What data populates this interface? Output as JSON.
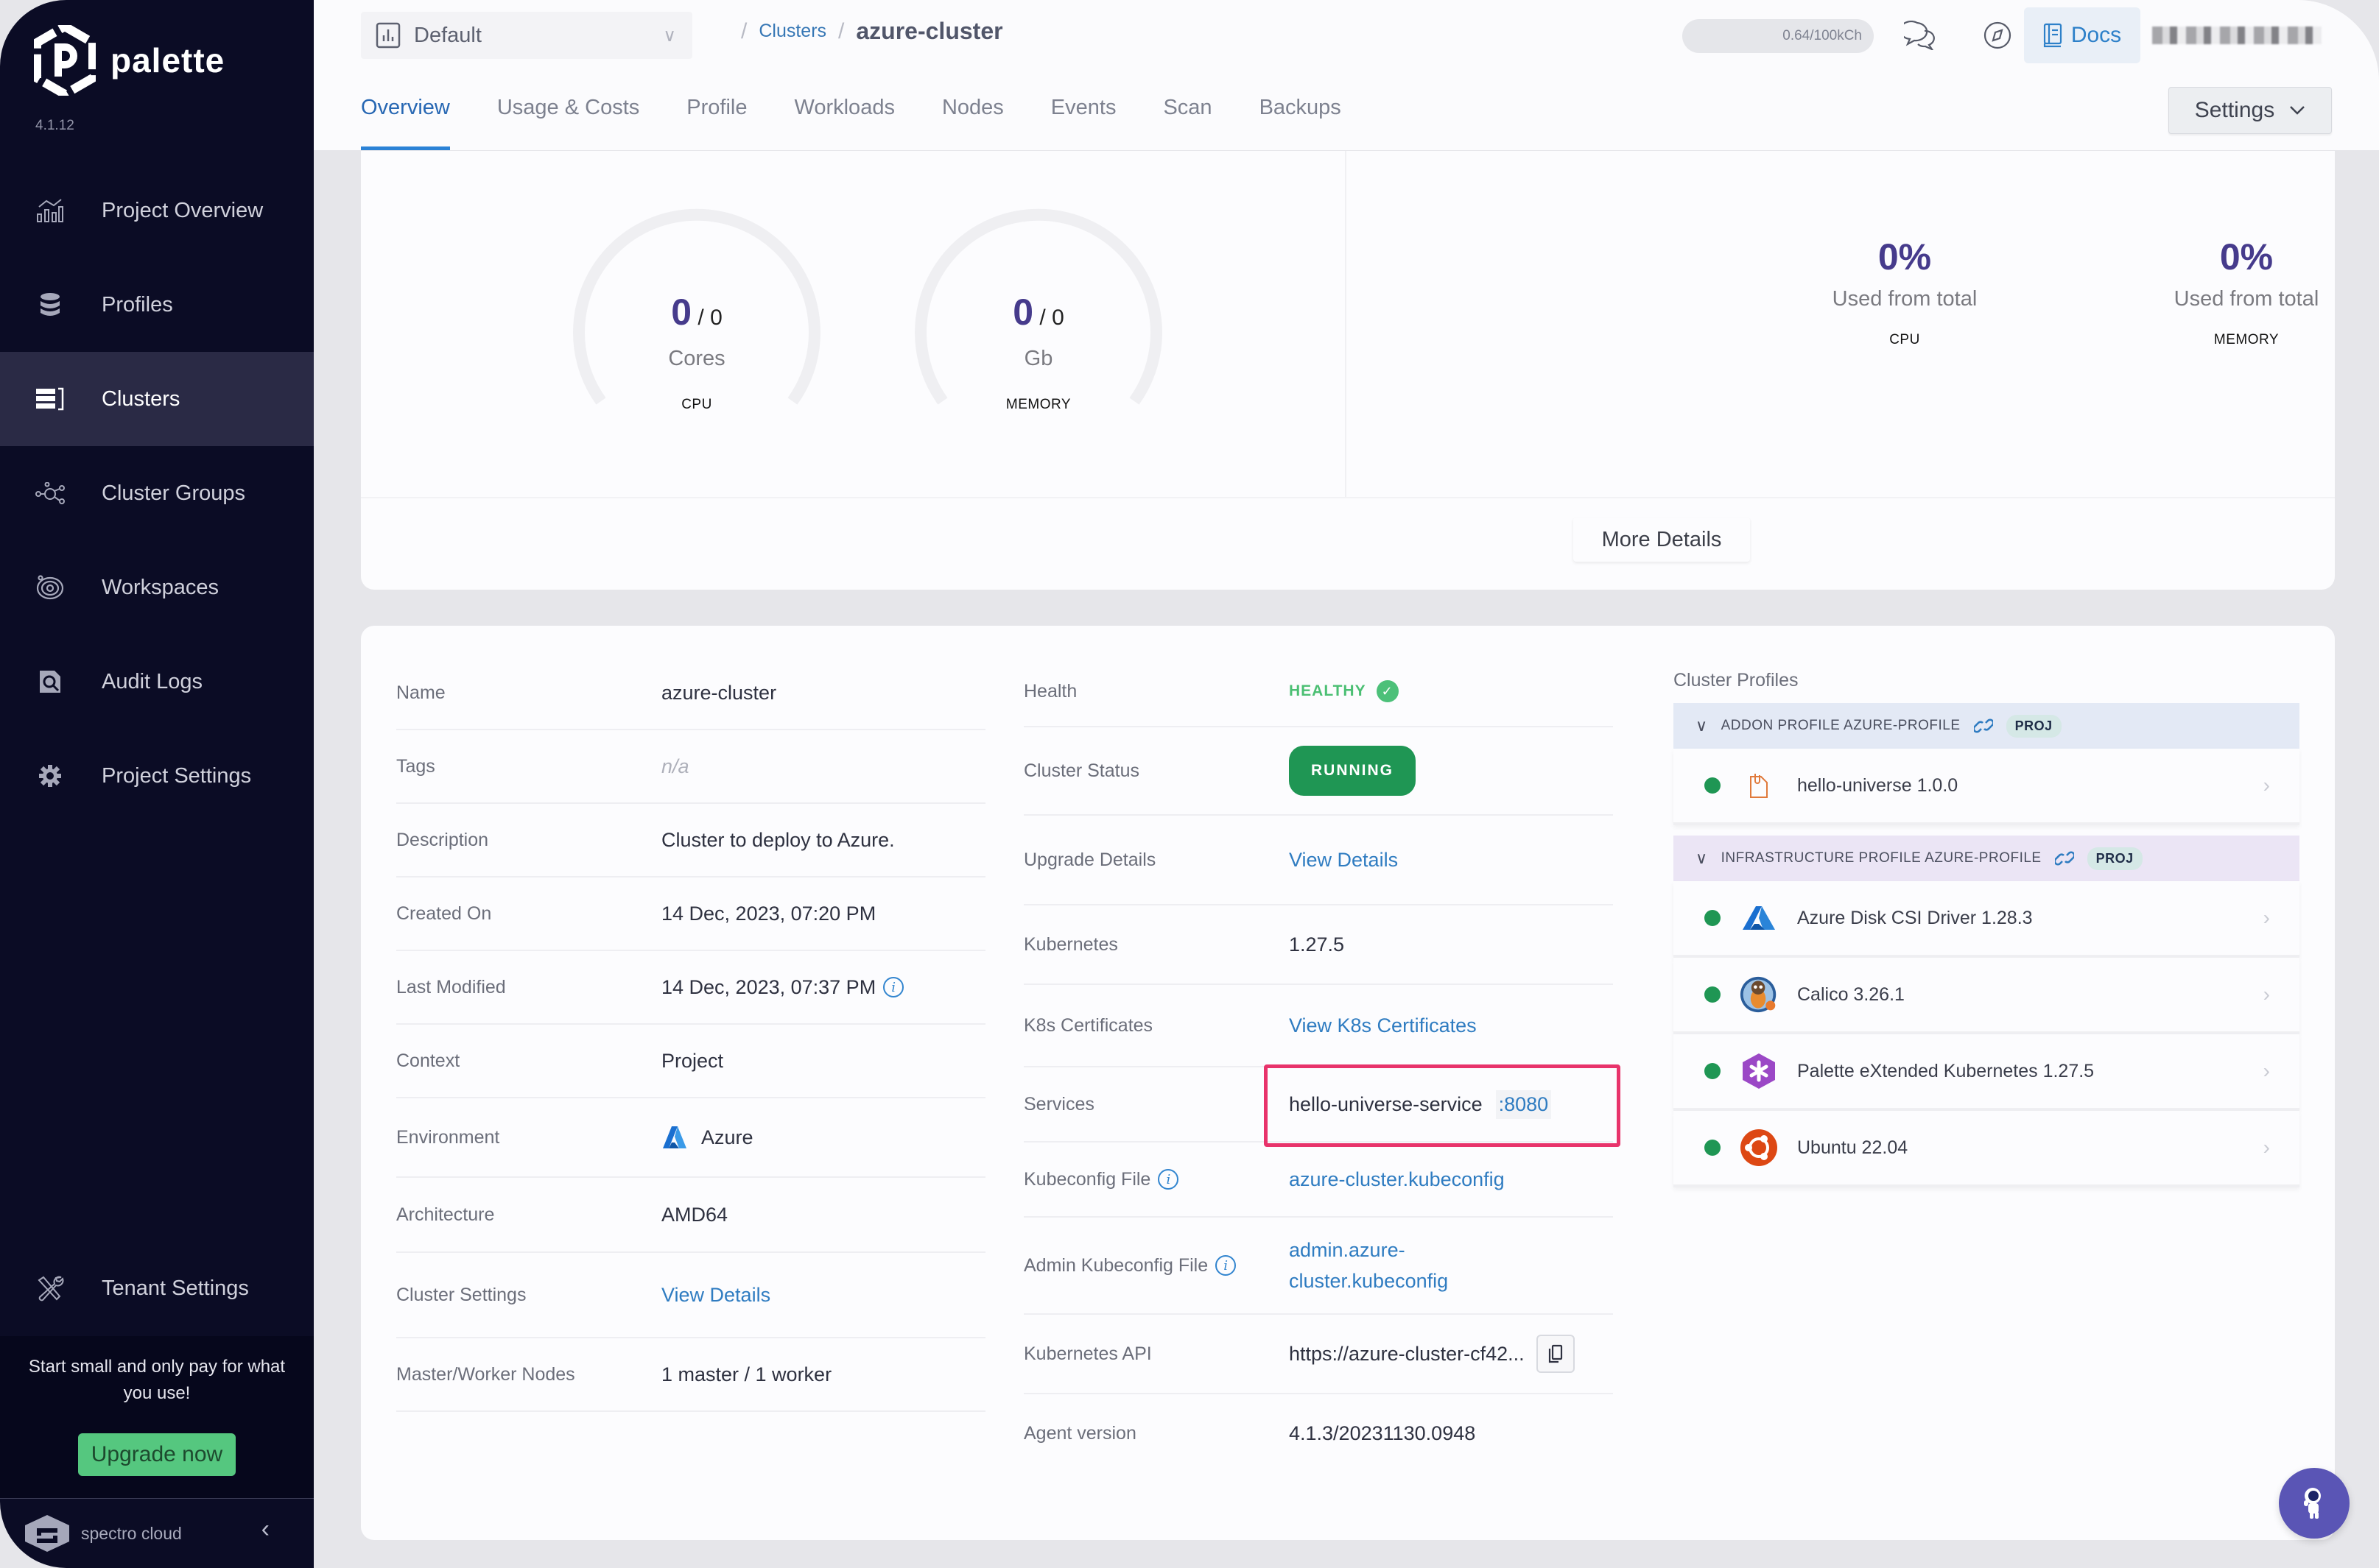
{
  "app": {
    "name": "palette",
    "version": "4.1.12",
    "footer_brand": "spectro cloud"
  },
  "sidebar": {
    "items": [
      {
        "label": "Project Overview",
        "icon": "chart-icon",
        "active": false
      },
      {
        "label": "Profiles",
        "icon": "stack-icon",
        "active": false
      },
      {
        "label": "Clusters",
        "icon": "clusters-icon",
        "active": true
      },
      {
        "label": "Cluster Groups",
        "icon": "network-icon",
        "active": false
      },
      {
        "label": "Workspaces",
        "icon": "orbit-icon",
        "active": false
      },
      {
        "label": "Audit Logs",
        "icon": "audit-search-icon",
        "active": false
      },
      {
        "label": "Project Settings",
        "icon": "gear-icon",
        "active": false
      }
    ],
    "tenant_settings": "Tenant Settings",
    "promo_text": "Start small and only pay for what you use!",
    "upgrade_label": "Upgrade now"
  },
  "header": {
    "project": "Default",
    "breadcrumb": {
      "parent": "Clusters",
      "current": "azure-cluster"
    },
    "credits": "0.64/100kCh",
    "docs_label": "Docs",
    "settings_label": "Settings"
  },
  "tabs": [
    {
      "label": "Overview",
      "active": true
    },
    {
      "label": "Usage & Costs",
      "active": false
    },
    {
      "label": "Profile",
      "active": false
    },
    {
      "label": "Workloads",
      "active": false
    },
    {
      "label": "Nodes",
      "active": false
    },
    {
      "label": "Events",
      "active": false
    },
    {
      "label": "Scan",
      "active": false
    },
    {
      "label": "Backups",
      "active": false
    }
  ],
  "usage": {
    "cpu": {
      "used": "0",
      "total": "0",
      "unit": "Cores",
      "label": "CPU",
      "fill_fraction": 0
    },
    "memory": {
      "used": "0",
      "total": "0",
      "unit": "Gb",
      "label": "MEMORY",
      "fill_fraction": 0
    },
    "cpu_pct": {
      "value": "0%",
      "sub": "Used from total",
      "label": "CPU"
    },
    "memory_pct": {
      "value": "0%",
      "sub": "Used from total",
      "label": "MEMORY"
    },
    "more_details_label": "More Details"
  },
  "details": {
    "left": [
      {
        "label": "Name",
        "value": "azure-cluster"
      },
      {
        "label": "Tags",
        "value": "n/a"
      },
      {
        "label": "Description",
        "value": "Cluster to deploy to Azure."
      },
      {
        "label": "Created On",
        "value": "14 Dec, 2023, 07:20 PM"
      },
      {
        "label": "Last Modified",
        "value": "14 Dec, 2023, 07:37 PM"
      },
      {
        "label": "Context",
        "value": "Project"
      },
      {
        "label": "Environment",
        "value": "Azure"
      },
      {
        "label": "Architecture",
        "value": "AMD64"
      },
      {
        "label": "Cluster Settings",
        "value": "View Details"
      },
      {
        "label": "Master/Worker Nodes",
        "value": "1 master / 1 worker"
      }
    ],
    "right": [
      {
        "label": "Health",
        "value": "HEALTHY"
      },
      {
        "label": "Cluster Status",
        "value": "RUNNING"
      },
      {
        "label": "Upgrade Details",
        "value": "View Details"
      },
      {
        "label": "Kubernetes",
        "value": "1.27.5"
      },
      {
        "label": "K8s Certificates",
        "value": "View K8s Certificates"
      },
      {
        "label": "Services",
        "value": "hello-universe-service",
        "port": ":8080"
      },
      {
        "label": "Kubeconfig File",
        "value": "azure-cluster.kubeconfig"
      },
      {
        "label": "Admin Kubeconfig File",
        "value": "admin.azure-cluster.kubeconfig"
      },
      {
        "label": "Kubernetes API",
        "value": "https://azure-cluster-cf42..."
      },
      {
        "label": "Agent version",
        "value": "4.1.3/20231130.0948"
      }
    ]
  },
  "profiles": {
    "title": "Cluster Profiles",
    "groups": [
      {
        "title": "ADDON PROFILE AZURE-PROFILE",
        "badge": "PROJ",
        "packs": [
          {
            "name": "hello-universe 1.0.0",
            "icon": "manifest-file-icon",
            "status": "healthy"
          }
        ]
      },
      {
        "title": "INFRASTRUCTURE PROFILE AZURE-PROFILE",
        "badge": "PROJ",
        "packs": [
          {
            "name": "Azure Disk CSI Driver 1.28.3",
            "icon": "azure-logo-icon",
            "status": "healthy"
          },
          {
            "name": "Calico 3.26.1",
            "icon": "calico-logo-icon",
            "status": "healthy"
          },
          {
            "name": "Palette eXtended Kubernetes 1.27.5",
            "icon": "pxk-logo-icon",
            "status": "healthy"
          },
          {
            "name": "Ubuntu 22.04",
            "icon": "ubuntu-logo-icon",
            "status": "healthy"
          }
        ]
      }
    ]
  },
  "colors": {
    "sidebar_bg": "#0b0c25",
    "accent_blue": "#2b82d6",
    "healthy_green": "#4bbf73",
    "running_green": "#1f9654",
    "gauge_purple": "#463b8c",
    "highlight_pink": "#e8336b",
    "upgrade_green": "#55c77f"
  }
}
